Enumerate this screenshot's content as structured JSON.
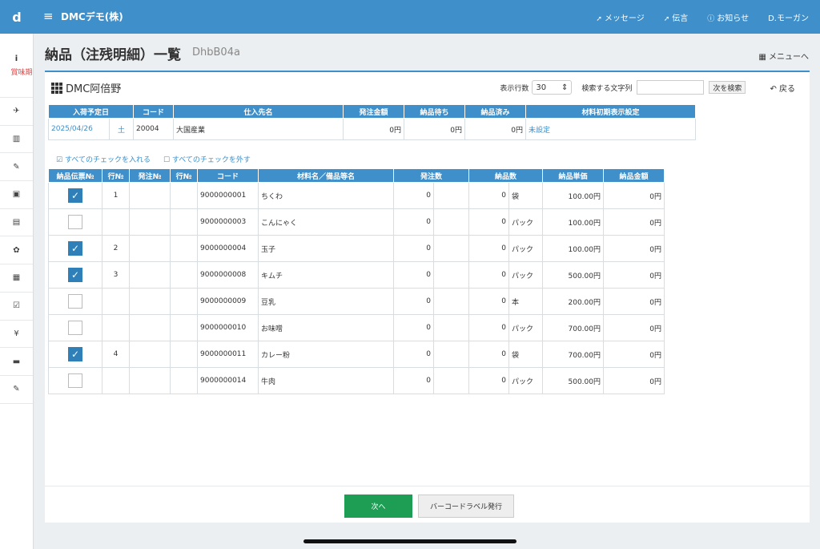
{
  "header": {
    "logo": "d",
    "app_title": "DMCデモ(株)",
    "nav": [
      {
        "icon": "paper-plane",
        "label": "メッセージ"
      },
      {
        "icon": "paper-plane",
        "label": "伝言"
      },
      {
        "icon": "info-circle",
        "label": "お知らせ"
      },
      {
        "icon": "",
        "label": "D.モーガン"
      }
    ]
  },
  "sidebar": {
    "first_icon": "i",
    "first_label": "賞味期",
    "icons": [
      "✈",
      "▥",
      "✎",
      "▣",
      "▤",
      "✿",
      "▦",
      "☑",
      "¥",
      "▬",
      "✎"
    ]
  },
  "page": {
    "title": "納品（注残明細）一覧",
    "code": "DhbB04a",
    "menu_label": "メニューへ"
  },
  "panel": {
    "store_name": "DMC阿倍野",
    "rows_label": "表示行数",
    "rows_value": "30",
    "search_label": "検索する文字列",
    "search_value": "",
    "search_button": "次を検索",
    "back_label": "戻る"
  },
  "summary": {
    "headers": [
      "入荷予定日",
      "コード",
      "仕入先名",
      "発注金額",
      "納品待ち",
      "納品済み",
      "材料初期表示設定"
    ],
    "date": "2025/04/26",
    "weekday": "土",
    "code": "20004",
    "supplier": "大国産業",
    "order_amount": "0円",
    "pending": "0円",
    "delivered": "0円",
    "setting": "未設定"
  },
  "check_all": "すべてのチェックを入れる",
  "uncheck_all": "すべてのチェックを外す",
  "detail": {
    "headers": [
      "納品伝票№",
      "行№",
      "発注№",
      "行№",
      "コード",
      "材料名／備品等名",
      "発注数",
      "納品数",
      "納品単価",
      "納品金額"
    ],
    "rows": [
      {
        "checked": true,
        "line": "1",
        "order_no": "",
        "order_line": "",
        "code": "9000000001",
        "name": "ちくわ",
        "order_qty": "0",
        "qty": "0",
        "unit": "袋",
        "price": "100.00円",
        "amount": "0円"
      },
      {
        "checked": false,
        "line": "",
        "order_no": "",
        "order_line": "",
        "code": "9000000003",
        "name": "こんにゃく",
        "order_qty": "0",
        "qty": "0",
        "unit": "パック",
        "price": "100.00円",
        "amount": "0円"
      },
      {
        "checked": true,
        "line": "2",
        "order_no": "",
        "order_line": "",
        "code": "9000000004",
        "name": "玉子",
        "order_qty": "0",
        "qty": "0",
        "unit": "パック",
        "price": "100.00円",
        "amount": "0円"
      },
      {
        "checked": true,
        "line": "3",
        "order_no": "",
        "order_line": "",
        "code": "9000000008",
        "name": "キムチ",
        "order_qty": "0",
        "qty": "0",
        "unit": "パック",
        "price": "500.00円",
        "amount": "0円"
      },
      {
        "checked": false,
        "line": "",
        "order_no": "",
        "order_line": "",
        "code": "9000000009",
        "name": "豆乳",
        "order_qty": "0",
        "qty": "0",
        "unit": "本",
        "price": "200.00円",
        "amount": "0円"
      },
      {
        "checked": false,
        "line": "",
        "order_no": "",
        "order_line": "",
        "code": "9000000010",
        "name": "お味噌",
        "order_qty": "0",
        "qty": "0",
        "unit": "パック",
        "price": "700.00円",
        "amount": "0円"
      },
      {
        "checked": true,
        "line": "4",
        "order_no": "",
        "order_line": "",
        "code": "9000000011",
        "name": "カレー粉",
        "order_qty": "0",
        "qty": "0",
        "unit": "袋",
        "price": "700.00円",
        "amount": "0円"
      },
      {
        "checked": false,
        "line": "",
        "order_no": "",
        "order_line": "",
        "code": "9000000014",
        "name": "牛肉",
        "order_qty": "0",
        "qty": "0",
        "unit": "パック",
        "price": "500.00円",
        "amount": "0円"
      }
    ]
  },
  "footer": {
    "next_button": "次へ",
    "barcode_button": "バーコードラベル発行"
  }
}
